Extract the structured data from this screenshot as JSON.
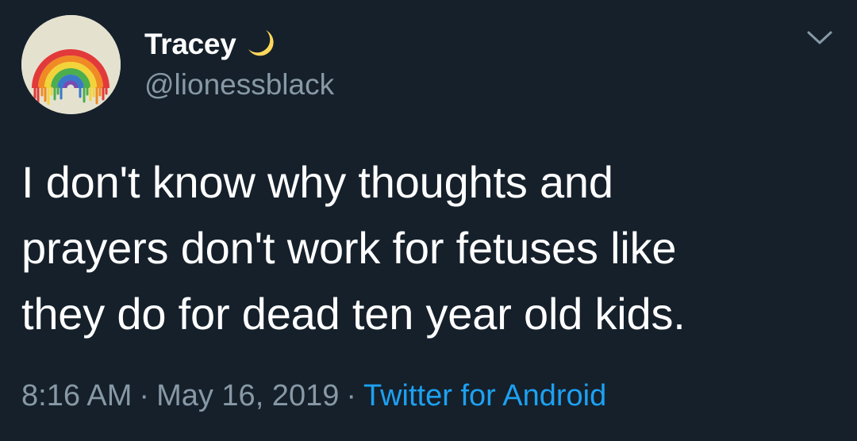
{
  "user": {
    "display_name": "Tracey",
    "handle": "@lionessblack",
    "name_emoji_icon": "crescent-moon-icon",
    "avatar_icon": "rainbow-avatar"
  },
  "tweet": {
    "text": "I don't know why thoughts and\nprayers don't work for fetuses like\nthey do for dead ten year old kids.",
    "time": "8:16 AM",
    "date": "May 16, 2019",
    "separator": "·",
    "source": "Twitter for Android"
  },
  "menu": {
    "icon": "chevron-down-icon"
  },
  "colors": {
    "background": "#15202b",
    "text_primary": "#ffffff",
    "text_secondary": "#8899a6",
    "link": "#1da1f2",
    "moon": "#ffd85a"
  }
}
